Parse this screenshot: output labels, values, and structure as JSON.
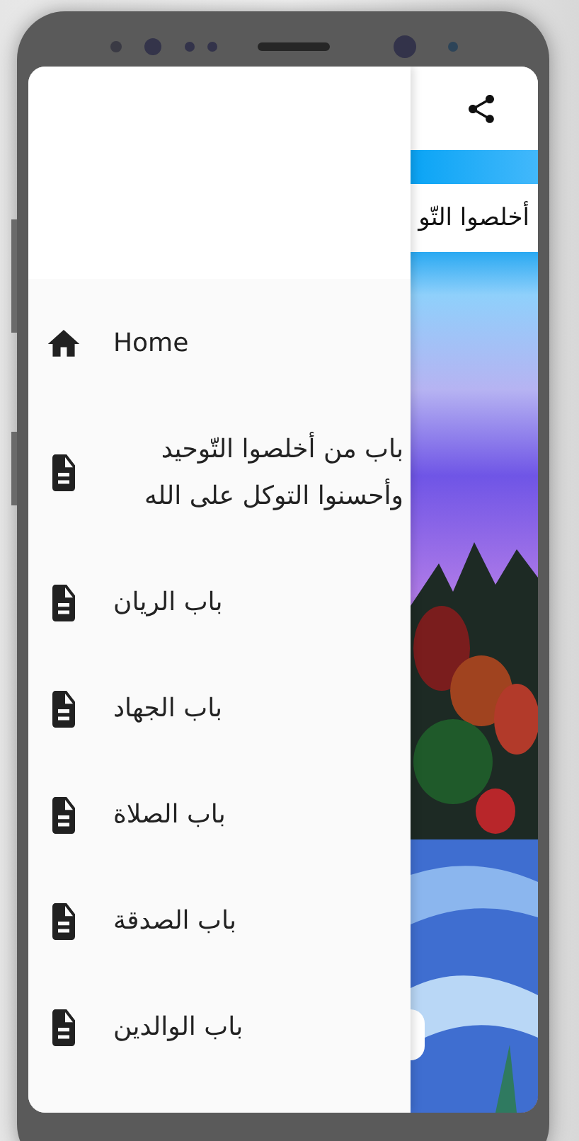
{
  "banner_text": "أخلصوا التّو",
  "drawer": {
    "items": [
      {
        "kind": "home",
        "label": "Home"
      },
      {
        "kind": "chapter",
        "label": "باب من أخلصوا التّوحيد وأحسنوا التوكل على الله"
      },
      {
        "kind": "chapter",
        "label": "باب الريان"
      },
      {
        "kind": "chapter",
        "label": "باب الجهاد"
      },
      {
        "kind": "chapter",
        "label": "باب الصلاة"
      },
      {
        "kind": "chapter",
        "label": "باب الصدقة"
      },
      {
        "kind": "chapter",
        "label": "باب الوالدين"
      }
    ]
  }
}
